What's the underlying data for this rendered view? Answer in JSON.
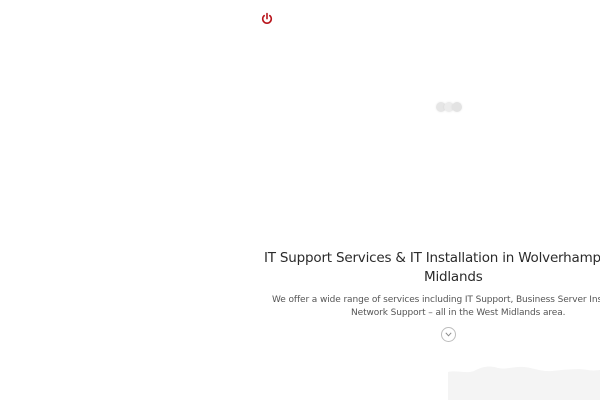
{
  "header": {
    "power_icon": "power-icon",
    "accent_color": "#b8141b"
  },
  "loader": {
    "icon": "loading-dots"
  },
  "hero": {
    "title_line1": "IT Support Services & IT Installation in Wolverhampton & the",
    "title_line2": "Midlands",
    "subtitle_line1": "We offer a wide range of services including IT Support, Business Server Installatio",
    "subtitle_line2": "Network Support – all in the West Midlands area.",
    "scroll_icon": "chevron-down-icon"
  }
}
